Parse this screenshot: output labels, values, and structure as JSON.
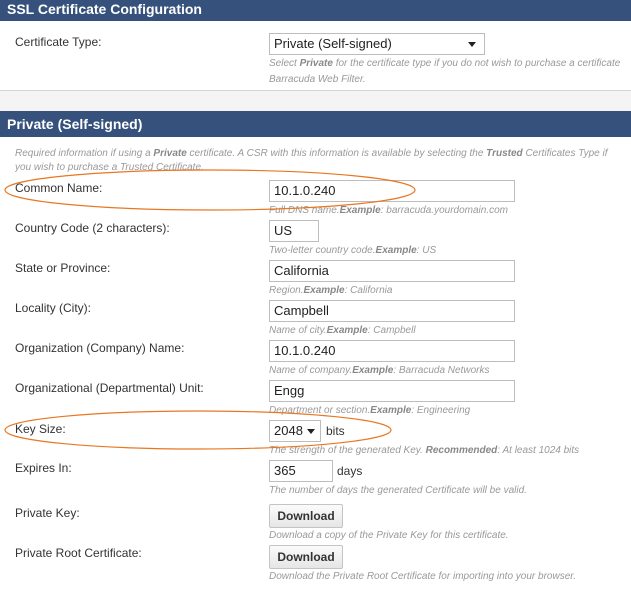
{
  "ssl_section": {
    "title": "SSL Certificate Configuration",
    "certificate_type": {
      "label": "Certificate Type:",
      "value": "Private (Self-signed)",
      "help_pre": "Select ",
      "help_bold": "Private",
      "help_post": " for the certificate type if you do not wish to purchase a certificate",
      "help_line2": "Barracuda Web Filter."
    }
  },
  "private_section": {
    "title": "Private (Self-signed)",
    "intro": {
      "pre": "Required information if using a ",
      "bold1": "Private",
      "mid": " certificate. A CSR with this information is available by selecting the ",
      "bold2": "Trusted",
      "post": " Certificates Type if",
      "line2": "you wish to purchase a Trusted Certificate."
    },
    "fields": {
      "common_name": {
        "label": "Common Name:",
        "value": "10.1.0.240",
        "help_pre": "Full DNS name.",
        "help_bold": "Example",
        "help_post": ": barracuda.yourdomain.com"
      },
      "country_code": {
        "label": "Country Code (2 characters):",
        "value": "US",
        "help_pre": "Two-letter country code.",
        "help_bold": "Example",
        "help_post": ": US"
      },
      "state": {
        "label": "State or Province:",
        "value": "California",
        "help_pre": "Region.",
        "help_bold": "Example",
        "help_post": ": California"
      },
      "locality": {
        "label": "Locality (City):",
        "value": "Campbell",
        "help_pre": "Name of city.",
        "help_bold": "Example",
        "help_post": ": Campbell"
      },
      "organization": {
        "label": "Organization (Company) Name:",
        "value": "10.1.0.240",
        "help_pre": "Name of company.",
        "help_bold": "Example",
        "help_post": ": Barracuda Networks"
      },
      "org_unit": {
        "label": "Organizational (Departmental) Unit:",
        "value": "Engg",
        "help_pre": "Department or section.",
        "help_bold": "Example",
        "help_post": ": Engineering"
      },
      "key_size": {
        "label": "Key Size:",
        "value": "2048",
        "unit": "bits",
        "help_pre": "The strength of the generated Key. ",
        "help_bold": "Recommended",
        "help_post": ": At least 1024 bits"
      },
      "expires_in": {
        "label": "Expires In:",
        "value": "365",
        "unit": "days",
        "help": "The number of days the generated Certificate will be valid."
      },
      "private_key": {
        "label": "Private Key:",
        "button": "Download",
        "help": "Download a copy of the Private Key for this certificate."
      },
      "private_root_cert": {
        "label": "Private Root Certificate:",
        "button": "Download",
        "help": "Download the Private Root Certificate for importing into your browser."
      }
    }
  },
  "annotations": {
    "highlight_color": "#e87722"
  }
}
